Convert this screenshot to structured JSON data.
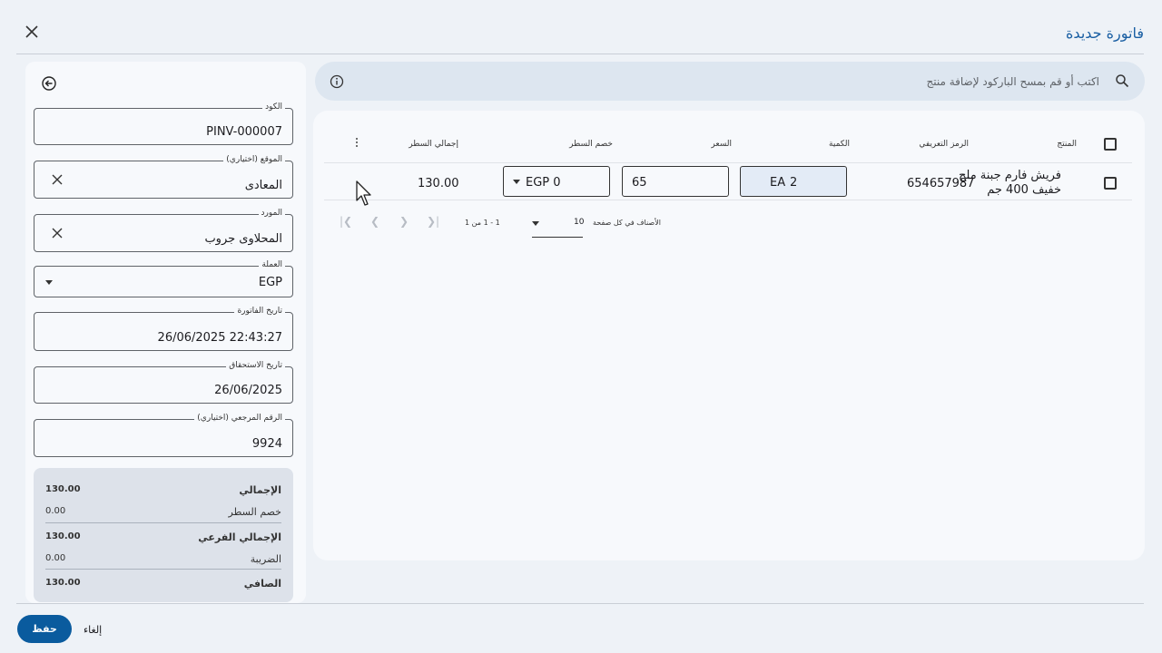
{
  "dialog": {
    "title": "فاتورة جديدة"
  },
  "search": {
    "placeholder": "اكتب أو قم بمسح الباركود لإضافة منتج"
  },
  "form": {
    "code_label": "الكود",
    "code_value": "PINV-000007",
    "location_label": "الموقع (اختياري)",
    "location_value": "المعادى",
    "supplier_label": "المورد",
    "supplier_value": "المحلاوى جروب",
    "currency_label": "العملة",
    "currency_value": "EGP",
    "invoice_date_label": "تاريخ الفاتورة",
    "invoice_date_value": "26/06/2025 22:43:27",
    "due_date_label": "تاريخ الاستحقاق",
    "due_date_value": "26/06/2025",
    "reference_label": "الرقم المرجعي (اختياري)",
    "reference_value": "9924"
  },
  "summary": {
    "total_label": "الإجمالي",
    "total_value": "130.00",
    "line_discount_label": "خصم السطر",
    "line_discount_value": "0.00",
    "subtotal_label": "الإجمالي الفرعي",
    "subtotal_value": "130.00",
    "tax_label": "الضريبة",
    "tax_value": "0.00",
    "net_label": "الصافي",
    "net_value": "130.00"
  },
  "table": {
    "headers": {
      "product": "المنتج",
      "barcode": "الرمز التعريفي",
      "quantity": "الكمية",
      "price": "السعر",
      "line_discount": "خصم السطر",
      "line_total": "إجمالي السطر"
    },
    "rows": [
      {
        "product_line1": "فريش فارم جبنة ملح",
        "product_line2": "خفيف 400 جم",
        "barcode": "654657987",
        "quantity": "2",
        "unit": "EA",
        "price": "65",
        "discount": "EGP 0",
        "line_total": "130.00"
      }
    ]
  },
  "pager": {
    "per_page_label": "الأصناف في كل صفحة",
    "per_page_value": "10",
    "range": "1 - 1 من 1"
  },
  "footer": {
    "save_label": "حفظ",
    "cancel_label": "إلغاء"
  },
  "colors": {
    "accent": "#0a5b9e",
    "title": "#1a5fa3",
    "background": "#eef2f7"
  },
  "icons": [
    "close-icon",
    "back-arrow-icon",
    "clear-icon",
    "caret-down-icon",
    "search-icon",
    "info-icon",
    "kebab-menu-icon",
    "first-page-icon",
    "prev-page-icon",
    "next-page-icon",
    "last-page-icon",
    "mouse-cursor-icon"
  ]
}
